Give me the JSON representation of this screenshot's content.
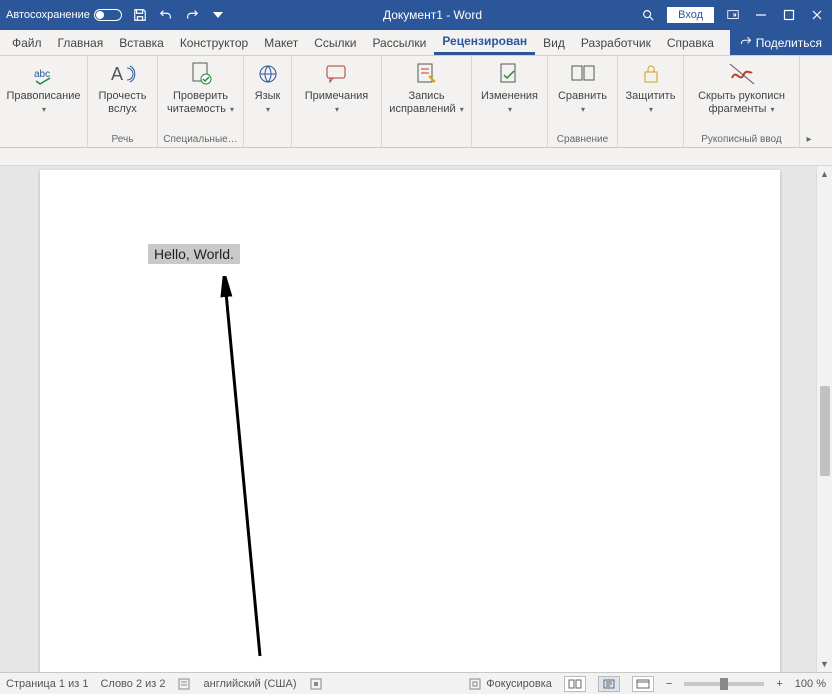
{
  "titlebar": {
    "autosave_label": "Автосохранение",
    "doc_title": "Документ1 - Word",
    "login": "Вход"
  },
  "tabs": {
    "file": "Файл",
    "home": "Главная",
    "insert": "Вставка",
    "design": "Конструктор",
    "layout": "Макет",
    "references": "Ссылки",
    "mailings": "Рассылки",
    "review": "Рецензирован",
    "view": "Вид",
    "developer": "Разработчик",
    "help": "Справка",
    "share": "Поделиться"
  },
  "ribbon": {
    "spelling": "Правописание",
    "read_aloud": "Прочесть вслух",
    "check_readability": "Проверить читаемость",
    "language": "Язык",
    "comments": "Примечания",
    "track_changes": "Запись исправлений",
    "changes": "Изменения",
    "compare": "Сравнить",
    "protect": "Защитить",
    "hide_ink": "Скрыть рукописн фрагменты",
    "group_speech": "Речь",
    "group_accessibility": "Специальные…",
    "group_compare": "Сравнение",
    "group_ink": "Рукописный ввод"
  },
  "document": {
    "selected_text": "Hello, World."
  },
  "status": {
    "page": "Страница 1 из 1",
    "words": "Слово 2 из 2",
    "language": "английский (США)",
    "focus": "Фокусировка",
    "zoom": "100 %"
  }
}
